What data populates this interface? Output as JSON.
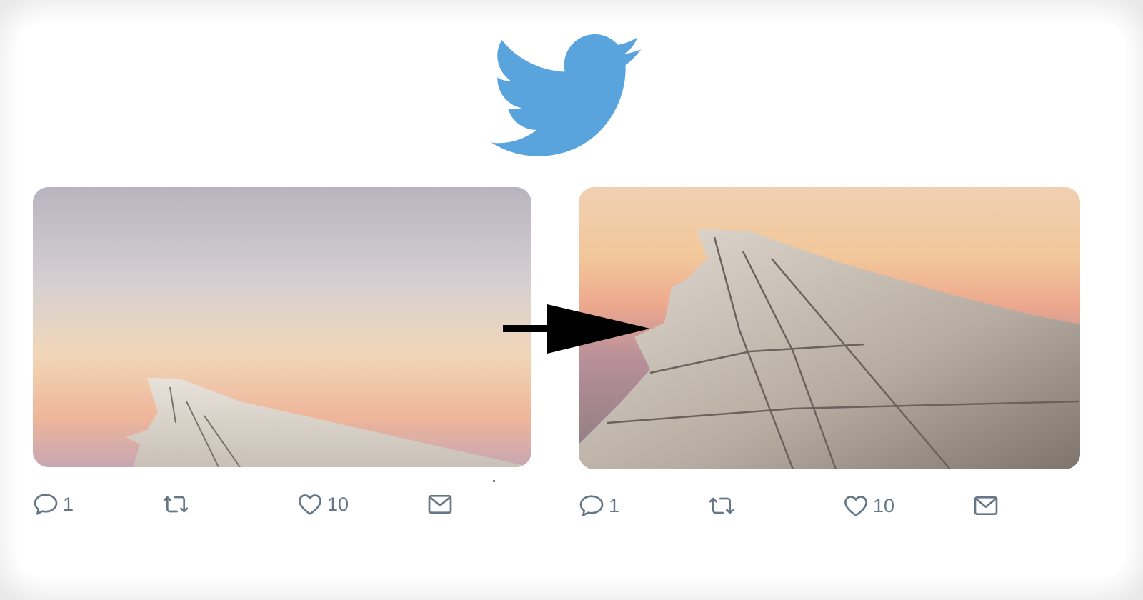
{
  "logo": {
    "icon": "twitter-bird-icon",
    "color": "#5aa4de"
  },
  "colors": {
    "icon_gray": "#657786",
    "arrow": "#000000",
    "page_background": "#e6e6e6",
    "card_background": "#ffffff"
  },
  "tweets": [
    {
      "image": {
        "description_icon": "airplane-wing-sunset-photo-cropped",
        "crop": "original"
      },
      "actions": {
        "reply": {
          "icon": "reply-icon",
          "count": "1"
        },
        "retweet": {
          "icon": "retweet-icon",
          "count": ""
        },
        "like": {
          "icon": "heart-icon",
          "count": "10"
        },
        "direct_message": {
          "icon": "envelope-icon",
          "count": ""
        }
      }
    },
    {
      "image": {
        "description_icon": "airplane-wing-sunset-photo-smart-cropped",
        "crop": "improved"
      },
      "actions": {
        "reply": {
          "icon": "reply-icon",
          "count": "1"
        },
        "retweet": {
          "icon": "retweet-icon",
          "count": ""
        },
        "like": {
          "icon": "heart-icon",
          "count": "10"
        },
        "direct_message": {
          "icon": "envelope-icon",
          "count": ""
        }
      }
    }
  ],
  "transition_arrow": {
    "icon": "right-arrow-icon"
  }
}
